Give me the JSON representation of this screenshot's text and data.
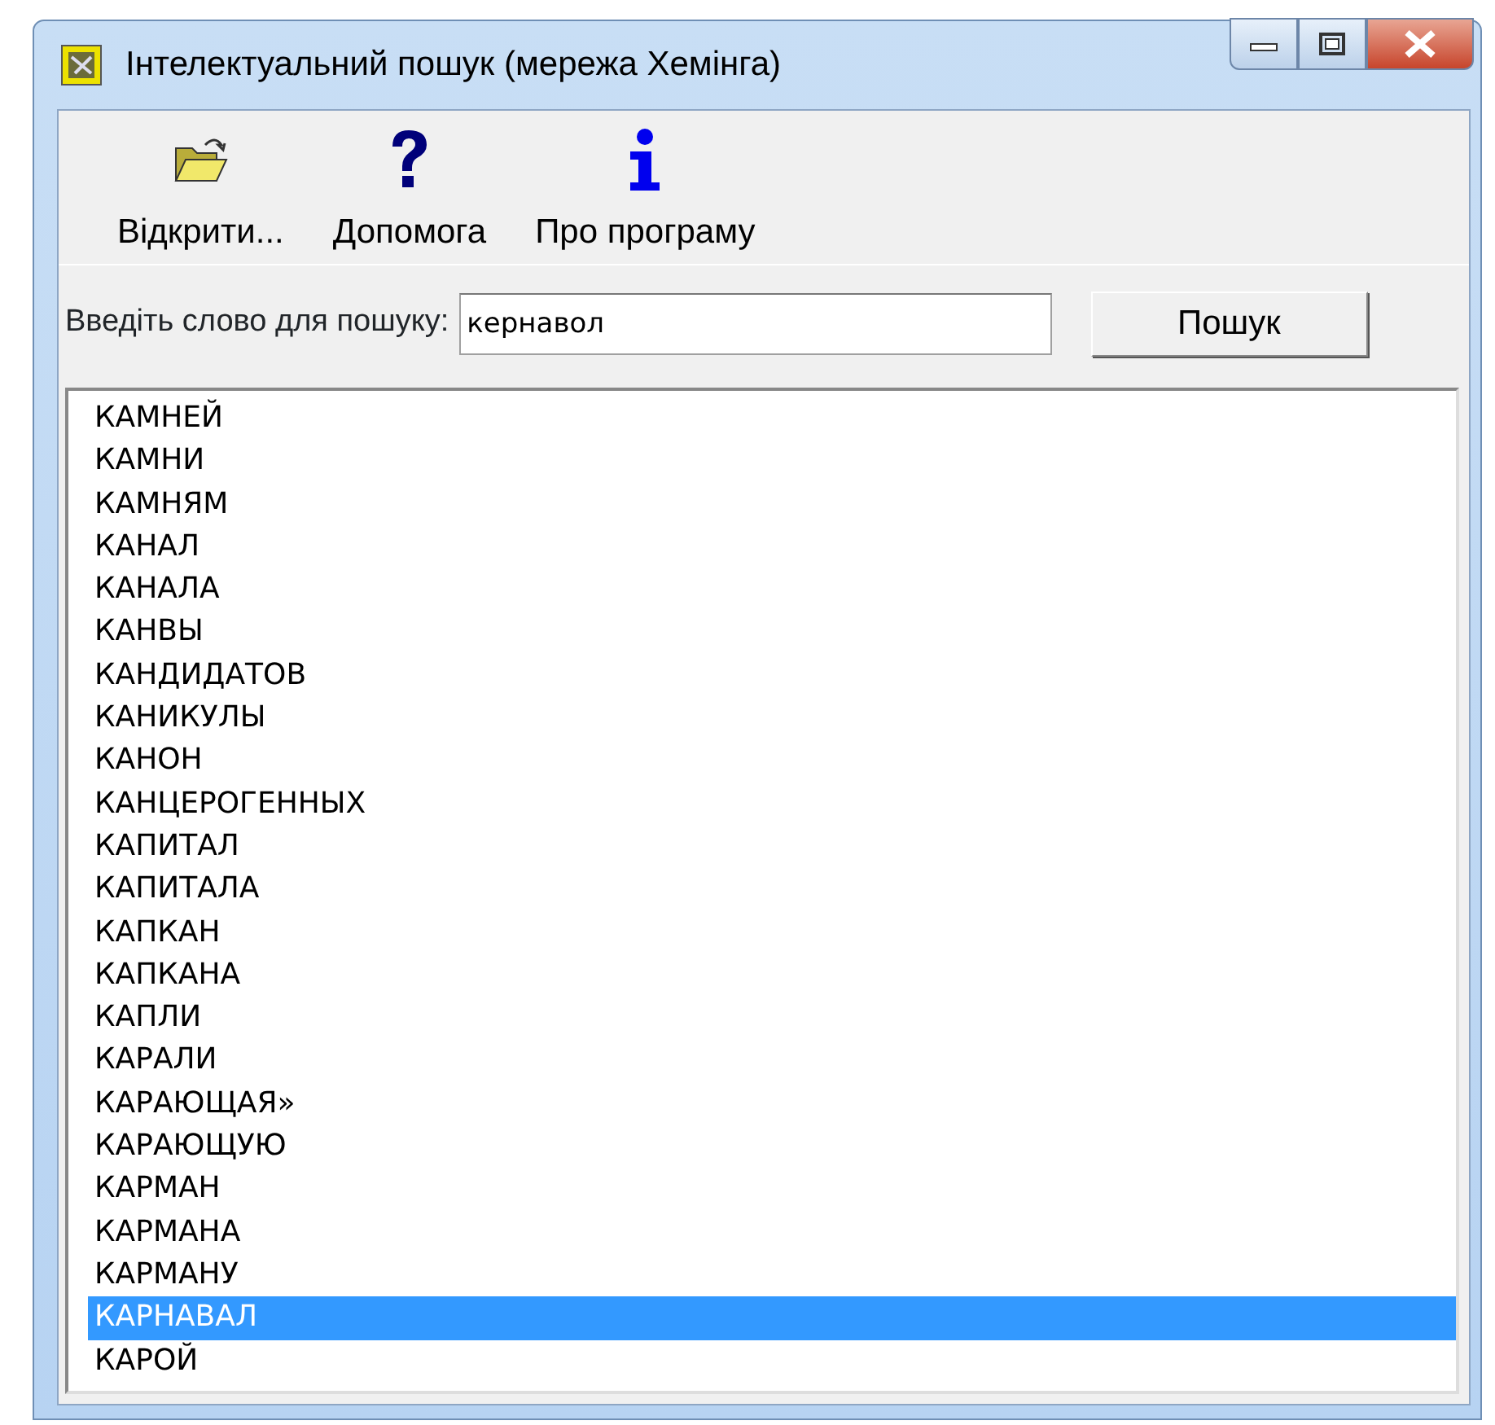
{
  "window": {
    "title": "Інтелектуальний пошук (мережа Хемінга)"
  },
  "toolbar": [
    {
      "kind": "open",
      "label": "Відкрити..."
    },
    {
      "kind": "help",
      "label": "Допомога"
    },
    {
      "kind": "info",
      "label": "Про програму"
    }
  ],
  "search": {
    "label": "Введіть слово для пошуку:",
    "value": "кернавол",
    "button": "Пошук"
  },
  "results": [
    {
      "text": "КАМНЕЙ",
      "selected": false
    },
    {
      "text": "КАМНИ",
      "selected": false
    },
    {
      "text": "КАМНЯМ",
      "selected": false
    },
    {
      "text": "КАНАЛ",
      "selected": false
    },
    {
      "text": "КАНАЛА",
      "selected": false
    },
    {
      "text": "КАНВЫ",
      "selected": false
    },
    {
      "text": "КАНДИДАТОВ",
      "selected": false
    },
    {
      "text": "КАНИКУЛЫ",
      "selected": false
    },
    {
      "text": "КАНОН",
      "selected": false
    },
    {
      "text": "КАНЦЕРОГЕННЫХ",
      "selected": false
    },
    {
      "text": "КАПИТАЛ",
      "selected": false
    },
    {
      "text": "КАПИТАЛА",
      "selected": false
    },
    {
      "text": "КАПКАН",
      "selected": false
    },
    {
      "text": "КАПКАНА",
      "selected": false
    },
    {
      "text": "КАПЛИ",
      "selected": false
    },
    {
      "text": "КАРАЛИ",
      "selected": false
    },
    {
      "text": "КАРАЮЩАЯ»",
      "selected": false
    },
    {
      "text": "КАРАЮЩУЮ",
      "selected": false
    },
    {
      "text": "КАРМАН",
      "selected": false
    },
    {
      "text": "КАРМАНА",
      "selected": false
    },
    {
      "text": "КАРМАНУ",
      "selected": false
    },
    {
      "text": "КАРНАВАЛ",
      "selected": true
    },
    {
      "text": "КАРОЙ",
      "selected": false
    }
  ]
}
